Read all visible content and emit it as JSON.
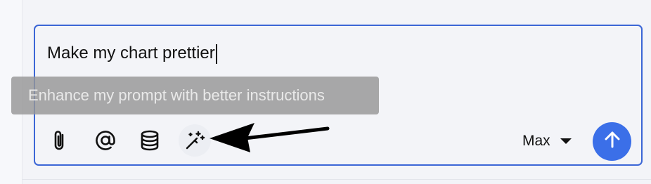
{
  "composer": {
    "input_text": "Make my chart prettier",
    "tooltip_text": "Enhance my prompt with better instructions",
    "model_label": "Max"
  },
  "toolbar": {
    "icons": [
      "paperclip-icon",
      "at-sign-icon",
      "database-icon",
      "magic-wand-icon"
    ]
  },
  "colors": {
    "accent": "#3b6fe8",
    "border": "#3b66d6",
    "background": "#f3f4f8"
  }
}
